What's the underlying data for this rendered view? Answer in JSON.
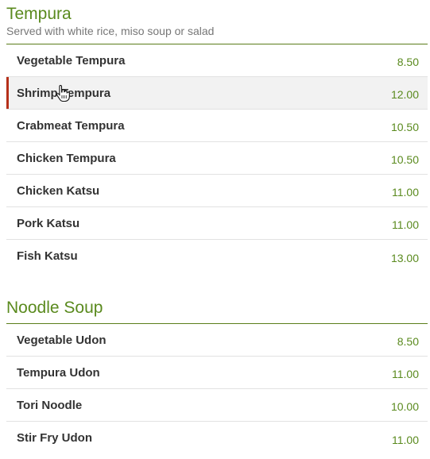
{
  "sections": [
    {
      "title": "Tempura",
      "subtitle": "Served with white rice, miso soup or salad",
      "items": [
        {
          "name": "Vegetable Tempura",
          "price": "8.50"
        },
        {
          "name": "Shrimp Tempura",
          "price": "12.00"
        },
        {
          "name": "Crabmeat Tempura",
          "price": "10.50"
        },
        {
          "name": "Chicken Tempura",
          "price": "10.50"
        },
        {
          "name": "Chicken Katsu",
          "price": "11.00"
        },
        {
          "name": "Pork Katsu",
          "price": "11.00"
        },
        {
          "name": "Fish Katsu",
          "price": "13.00"
        }
      ]
    },
    {
      "title": "Noodle Soup",
      "items": [
        {
          "name": "Vegetable Udon",
          "price": "8.50"
        },
        {
          "name": "Tempura Udon",
          "price": "11.00"
        },
        {
          "name": "Tori Noodle",
          "price": "10.00"
        },
        {
          "name": "Stir Fry Udon",
          "price": "11.00"
        }
      ]
    }
  ],
  "colors": {
    "accent_green": "#5a8a1e",
    "active_marker": "#b5301a",
    "hover_background": "#f2f2f2"
  },
  "cursor_icon": "hand-pointer-icon"
}
